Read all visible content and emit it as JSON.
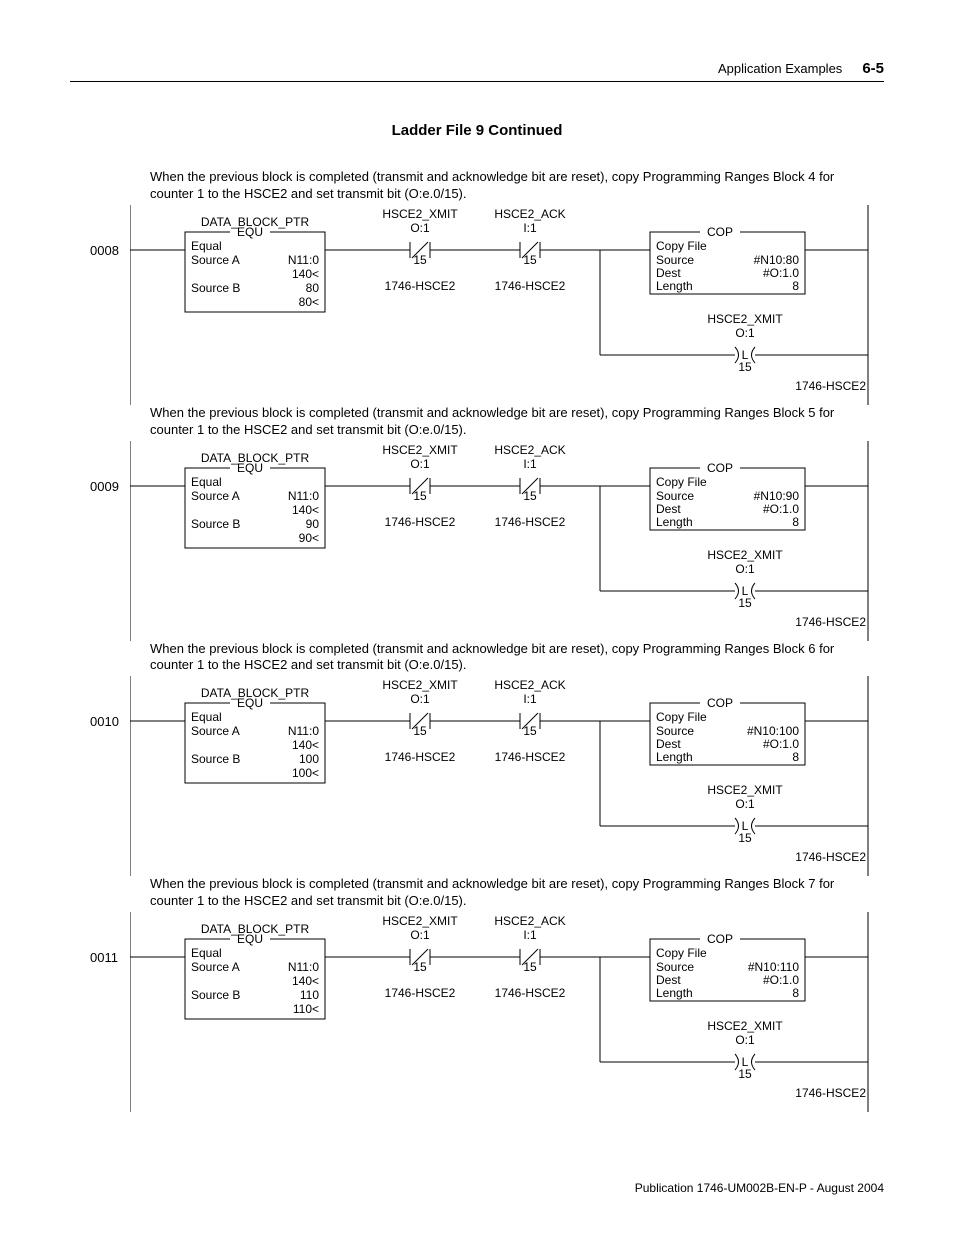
{
  "header": {
    "title": "Application Examples",
    "pageNum": "6-5"
  },
  "sectionTitle": "Ladder File 9 Continued",
  "footer": "Publication 1746-UM002B-EN-P - August 2004",
  "rungs": [
    {
      "num": "0008",
      "comment": "When the previous block is completed (transmit and acknowledge bit are reset), copy Programming Ranges Block 4 for counter 1 to the HSCE2 and set transmit bit (O:e.0/15).",
      "equ": {
        "top": "DATA_BLOCK_PTR",
        "tag": "EQU",
        "l1": "Equal",
        "l2a": "Source A",
        "l2b": "N11:0",
        "l3b": "140<",
        "l4a": "Source B",
        "l4b": "80",
        "l5b": "80<"
      },
      "xio1": {
        "name": "HSCE2_XMIT",
        "addr": "O:1",
        "bit": "15",
        "mod": "1746-HSCE2"
      },
      "xio2": {
        "name": "HSCE2_ACK",
        "addr": "I:1",
        "bit": "15",
        "mod": "1746-HSCE2"
      },
      "cop": {
        "tag": "COP",
        "l1": "Copy File",
        "l2a": "Source",
        "l2b": "#N10:80",
        "l3a": "Dest",
        "l3b": "#O:1.0",
        "l4a": "Length",
        "l4b": "8"
      },
      "otl": {
        "name": "HSCE2_XMIT",
        "addr": "O:1",
        "bit": "15",
        "mod": "1746-HSCE2"
      }
    },
    {
      "num": "0009",
      "comment": "When the previous block is completed (transmit and acknowledge bit are reset), copy Programming Ranges Block 5 for counter 1 to the HSCE2 and set transmit bit (O:e.0/15).",
      "equ": {
        "top": "DATA_BLOCK_PTR",
        "tag": "EQU",
        "l1": "Equal",
        "l2a": "Source A",
        "l2b": "N11:0",
        "l3b": "140<",
        "l4a": "Source B",
        "l4b": "90",
        "l5b": "90<"
      },
      "xio1": {
        "name": "HSCE2_XMIT",
        "addr": "O:1",
        "bit": "15",
        "mod": "1746-HSCE2"
      },
      "xio2": {
        "name": "HSCE2_ACK",
        "addr": "I:1",
        "bit": "15",
        "mod": "1746-HSCE2"
      },
      "cop": {
        "tag": "COP",
        "l1": "Copy File",
        "l2a": "Source",
        "l2b": "#N10:90",
        "l3a": "Dest",
        "l3b": "#O:1.0",
        "l4a": "Length",
        "l4b": "8"
      },
      "otl": {
        "name": "HSCE2_XMIT",
        "addr": "O:1",
        "bit": "15",
        "mod": "1746-HSCE2"
      }
    },
    {
      "num": "0010",
      "comment": "When the previous block is completed (transmit and acknowledge bit are reset), copy Programming Ranges Block 6 for counter 1 to the HSCE2 and set transmit bit (O:e.0/15).",
      "equ": {
        "top": "DATA_BLOCK_PTR",
        "tag": "EQU",
        "l1": "Equal",
        "l2a": "Source A",
        "l2b": "N11:0",
        "l3b": "140<",
        "l4a": "Source B",
        "l4b": "100",
        "l5b": "100<"
      },
      "xio1": {
        "name": "HSCE2_XMIT",
        "addr": "O:1",
        "bit": "15",
        "mod": "1746-HSCE2"
      },
      "xio2": {
        "name": "HSCE2_ACK",
        "addr": "I:1",
        "bit": "15",
        "mod": "1746-HSCE2"
      },
      "cop": {
        "tag": "COP",
        "l1": "Copy File",
        "l2a": "Source",
        "l2b": "#N10:100",
        "l3a": "Dest",
        "l3b": "#O:1.0",
        "l4a": "Length",
        "l4b": "8"
      },
      "otl": {
        "name": "HSCE2_XMIT",
        "addr": "O:1",
        "bit": "15",
        "mod": "1746-HSCE2"
      }
    },
    {
      "num": "0011",
      "comment": "When the previous block is completed (transmit and acknowledge bit are reset), copy Programming Ranges Block 7 for counter 1 to the HSCE2 and set transmit bit (O:e.0/15).",
      "equ": {
        "top": "DATA_BLOCK_PTR",
        "tag": "EQU",
        "l1": "Equal",
        "l2a": "Source A",
        "l2b": "N11:0",
        "l3b": "140<",
        "l4a": "Source B",
        "l4b": "110",
        "l5b": "110<"
      },
      "xio1": {
        "name": "HSCE2_XMIT",
        "addr": "O:1",
        "bit": "15",
        "mod": "1746-HSCE2"
      },
      "xio2": {
        "name": "HSCE2_ACK",
        "addr": "I:1",
        "bit": "15",
        "mod": "1746-HSCE2"
      },
      "cop": {
        "tag": "COP",
        "l1": "Copy File",
        "l2a": "Source",
        "l2b": "#N10:110",
        "l3a": "Dest",
        "l3b": "#O:1.0",
        "l4a": "Length",
        "l4b": "8"
      },
      "otl": {
        "name": "HSCE2_XMIT",
        "addr": "O:1",
        "bit": "15",
        "mod": "1746-HSCE2"
      }
    }
  ]
}
